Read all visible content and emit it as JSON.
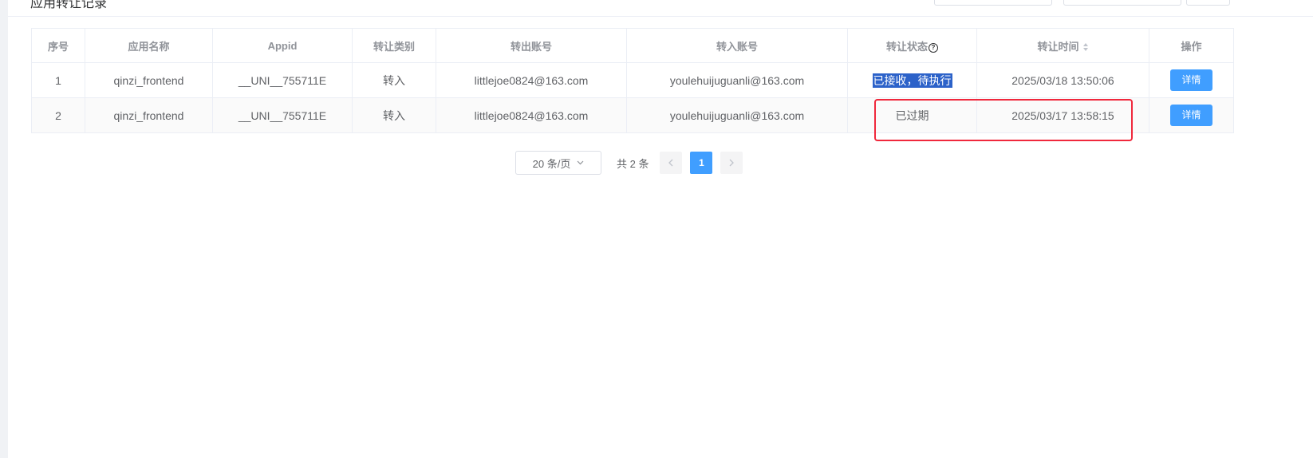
{
  "page": {
    "title_partial": "应用转让记录"
  },
  "table": {
    "headers": {
      "index": "序号",
      "app_name": "应用名称",
      "appid": "Appid",
      "transfer_type": "转让类别",
      "from_account": "转出账号",
      "to_account": "转入账号",
      "status": "转让状态",
      "time": "转让时间",
      "action": "操作"
    },
    "rows": [
      {
        "index": "1",
        "app_name": "qinzi_frontend",
        "appid": "__UNI__755711E",
        "transfer_type": "转入",
        "from_account": "littlejoe0824@163.com",
        "to_account": "youlehuijuguanli@163.com",
        "status": "已接收，待执行",
        "time": "2025/03/18 13:50:06",
        "action": "详情"
      },
      {
        "index": "2",
        "app_name": "qinzi_frontend",
        "appid": "__UNI__755711E",
        "transfer_type": "转入",
        "from_account": "littlejoe0824@163.com",
        "to_account": "youlehuijuguanli@163.com",
        "status": "已过期",
        "time": "2025/03/17 13:58:15",
        "action": "详情"
      }
    ]
  },
  "pagination": {
    "page_size": "20 条/页",
    "total": "共 2 条",
    "current_page": "1"
  },
  "icons": {
    "status_help": "question-circle-icon",
    "time_sort": "sort-caret-icon",
    "prev": "chevron-left-icon",
    "next": "chevron-right-icon",
    "dropdown": "chevron-down-icon"
  },
  "colors": {
    "primary": "#409eff",
    "highlight_border": "#f0283c",
    "selection": "#2c62c9"
  }
}
